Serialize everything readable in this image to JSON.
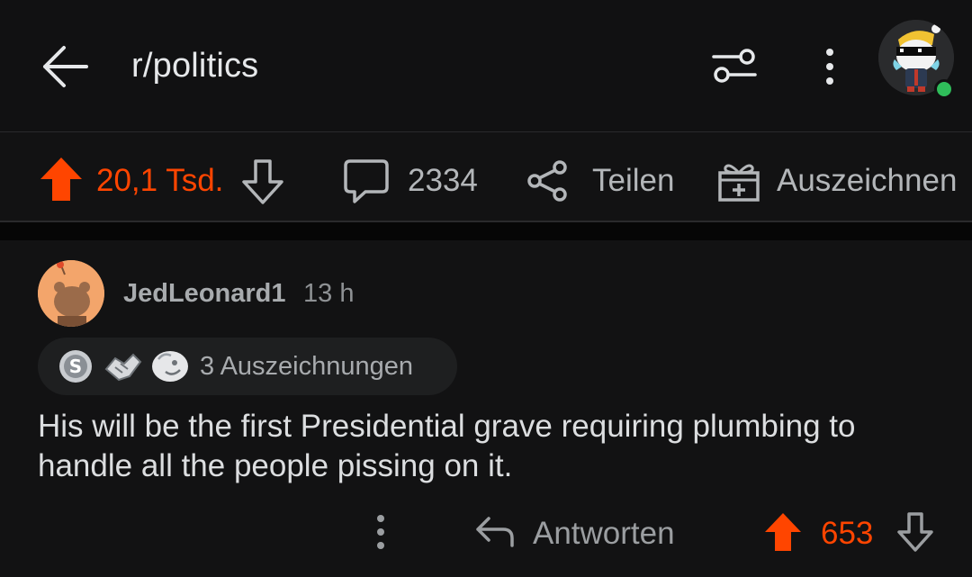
{
  "header": {
    "subreddit": "r/politics",
    "back_icon": "arrow-left-icon",
    "filter_icon": "sliders-icon",
    "menu_icon": "more-vertical-icon"
  },
  "post_actions": {
    "votes": "20,1 Tsd.",
    "comments": "2334",
    "share_label": "Teilen",
    "award_label": "Auszeichnen",
    "vote_color": "#ff4500"
  },
  "comment": {
    "username": "JedLeonard1",
    "time": "13 h",
    "awards_label": "3 Auszeichnungen",
    "text": "His will be the first Presidential grave requiring plumbing to handle all the people pissing on it.",
    "reply_label": "Antworten",
    "score": "653"
  },
  "status": {
    "online_color": "#2fbd5a"
  }
}
